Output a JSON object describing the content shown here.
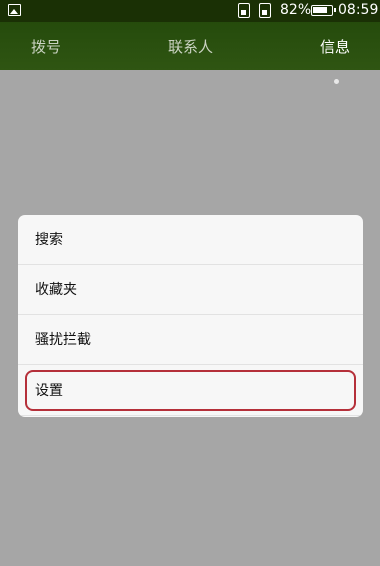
{
  "status_bar": {
    "battery_percent": "82%",
    "battery_level": 0.82,
    "time": "08:59",
    "icons": [
      "picture-icon",
      "sim1-icon",
      "sim2-icon",
      "battery-icon"
    ]
  },
  "tabs": [
    {
      "label": "拨号",
      "active": false
    },
    {
      "label": "联系人",
      "active": false
    },
    {
      "label": "信息",
      "active": true
    }
  ],
  "menu": {
    "items": [
      {
        "label": "搜索"
      },
      {
        "label": "收藏夹"
      },
      {
        "label": "骚扰拦截"
      },
      {
        "label": "设置",
        "highlighted": true
      }
    ],
    "highlight_color": "#b5303a"
  },
  "colors": {
    "overlay": "#a6a6a6",
    "tabbar": "#2f5512",
    "menu_bg": "#f7f7f7"
  }
}
